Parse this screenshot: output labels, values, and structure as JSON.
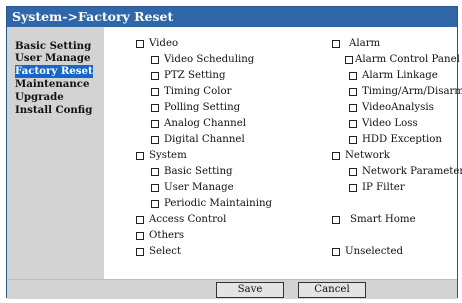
{
  "window": {
    "title": "System->Factory Reset"
  },
  "sidebar": {
    "items": [
      {
        "label": "Basic Setting",
        "active": false
      },
      {
        "label": "User Manage",
        "active": false
      },
      {
        "label": "Factory Reset",
        "active": true
      },
      {
        "label": "Maintenance",
        "active": false
      },
      {
        "label": "Upgrade",
        "active": false
      },
      {
        "label": "Install Config",
        "active": false
      }
    ]
  },
  "left_column": {
    "video": {
      "label": "Video",
      "items": [
        "Video Scheduling",
        "PTZ Setting",
        "Timing Color",
        "Polling Setting",
        "Analog Channel",
        "Digital Channel"
      ]
    },
    "system": {
      "label": "System",
      "items": [
        "Basic Setting",
        "User Manage",
        "Periodic Maintaining"
      ]
    },
    "access_control": "Access Control",
    "others": "Others",
    "select": "Select"
  },
  "right_column": {
    "alarm": {
      "label": "Alarm",
      "items": [
        "Alarm Control Panel",
        "Alarm Linkage",
        "Timing/Arm/Disarm",
        "VideoAnalysis",
        "Video Loss",
        "HDD Exception"
      ]
    },
    "network": {
      "label": "Network",
      "items": [
        "Network Parameter",
        "IP Filter"
      ]
    },
    "smart_home": "Smart Home",
    "unselected": "Unselected"
  },
  "buttons": {
    "save": "Save",
    "cancel": "Cancel"
  },
  "colors": {
    "title_bg": "#2f67a8",
    "active_item_bg": "#1466c8",
    "panel_bg": "#d3d3d3"
  }
}
